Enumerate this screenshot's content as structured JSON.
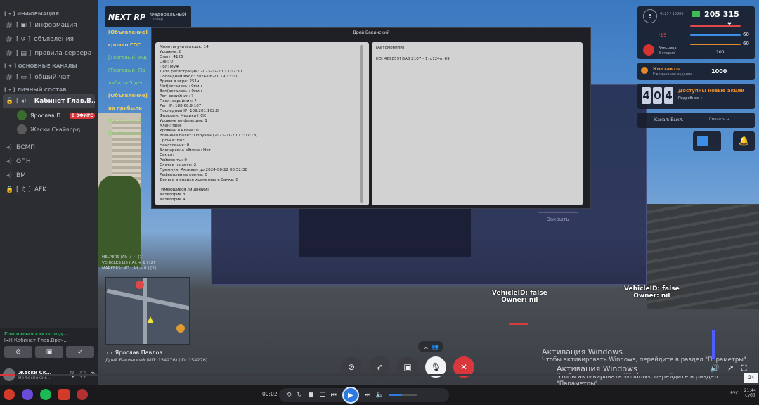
{
  "sidebar": {
    "categories": [
      {
        "label": "информация"
      },
      {
        "label": "основные каналы"
      },
      {
        "label": "личный состав"
      }
    ],
    "info_channels": [
      "информация",
      "объявления",
      "правила-сервера"
    ],
    "main_channels": [
      "общий-чат"
    ],
    "active_voice": "Кабинет Глав.В...",
    "voice_users": [
      {
        "name": "Ярослав П...",
        "live_badge": "В ЭФИРЕ"
      },
      {
        "name": "Жески Скайворд",
        "live_badge": ""
      }
    ],
    "voice_channels": [
      "БСМП",
      "ОПН",
      "ВМ",
      "AFK"
    ],
    "voice_panel": {
      "status": "Голосовая связь под...",
      "channel": "Кабинет Глав.Врач..."
    },
    "user": {
      "name": "Жески Ск...",
      "status": "Не беспокои..."
    }
  },
  "game": {
    "logo": {
      "brand": "NEXT RP",
      "server": "Федеральный",
      "sub": "Сервер"
    },
    "chat_lines": [
      {
        "text": "[Объявление]",
        "type": "y"
      },
      {
        "text": "срочно ГПС",
        "type": "y"
      },
      {
        "text": "[Торговый] Ищ",
        "type": "g"
      },
      {
        "text": "[Торговый] Пр",
        "type": "g"
      },
      {
        "text": "либо за 5 дел",
        "type": "g"
      },
      {
        "text": "[Объявление]",
        "type": "y"
      },
      {
        "text": "на прибыли",
        "type": "y"
      },
      {
        "text": "[Глобальный]",
        "type": "g"
      },
      {
        "text": "[Глобальный]",
        "type": "g"
      }
    ],
    "modal": {
      "title": "Дрей Бакинский",
      "left_lines": [
        "Монеты учителя.шк: 14",
        "Уровень: 8",
        "Опыт: 4125",
        "Онн: 0",
        "Пол: Муж",
        "Дата регистрации: 2023-07-20 13:02:30",
        "Последний вход: 2024-08-21 19:13:01",
        "Время в игре: 251ч",
        "Mut(осталось): 0мин",
        "Ban(осталось): 0мин",
        "Рег. серийник: ?",
        "Посл. серийник: ?",
        "Рег. IP: 188.68.9.107",
        "Последний IP: 109.201.102.8",
        "Фракция: Медика НСК",
        "Уровень во фракции: 1",
        "Клан: false",
        "Уровень в клане: 0",
        "Военный билет: Получен (2023-07-20 17:07:18)",
        "Срочка: Нет",
        "Неистовник: 0",
        "Блокировка обмена: Нет",
        "Семья: -",
        "Рейсконты: 0",
        "Слотов на авто: 2",
        "Премиум: Активен до 2024-08-22 00:52:38",
        "Реферальные коины: 0",
        "Деньги в кнайке хранимые в банке: 0",
        "",
        "[Имеющиеся лицензии]",
        "Категория B",
        "Категория A"
      ],
      "right_lines": [
        "[Автомобили]",
        "",
        "[ID: 469859] ВАЗ 2107  - 1то124от69"
      ],
      "close_label": "Закрыть"
    },
    "hud": {
      "level": "8",
      "level_sub": "4125 / 10000",
      "money": "205 315",
      "wanted": "-19",
      "hp": "60",
      "armor": "60",
      "hunger": "100",
      "health_status": "Больница",
      "health_status_sub": "3 стадия",
      "bars": [
        {
          "color": "#e04848",
          "pct": 0.95
        },
        {
          "color": "#3d8ee8",
          "pct": 0.95
        },
        {
          "color": "#e58a2a",
          "pct": 0.95
        }
      ],
      "task": {
        "title": "Контакты",
        "sub": "Ежедневное задание",
        "amount": "1000"
      },
      "clock": {
        "h1": "4",
        "m1": "0",
        "m2": "4",
        "title": "Доступны новые акции",
        "sub": "Подробнее →"
      },
      "channel": {
        "label": "Канал: Выкл.",
        "change": "Сменить →"
      }
    },
    "overlay_labels": [
      {
        "vehicle": "VehicleID: false",
        "owner": "Owner: nil"
      },
      {
        "vehicle": "VehicleID: false",
        "owner": "Owner: nil"
      }
    ],
    "hud_lines": [
      "HELPERS (Alt + •)   [1]",
      "VEHICLES  Ы5 ( Alt + 1 )  [2]",
      "MARKERS: NO ( Alt + 0 )  [3]"
    ],
    "caption_name": "Ярослав Павлов",
    "caption_bottom": "Дрей Бакинский (ИП: 154276) (ID: 154276)"
  },
  "activation": {
    "title": "Активация Windows",
    "text": "Чтобы активировать Windows, перейдите в раздел \"Параметры\"."
  },
  "player": {
    "time": "00:02",
    "progress": 0.02,
    "volume": 0.45,
    "tray_lang": "РУС",
    "tray_time": "21:44",
    "tray_day": "субб",
    "tag": "24"
  }
}
